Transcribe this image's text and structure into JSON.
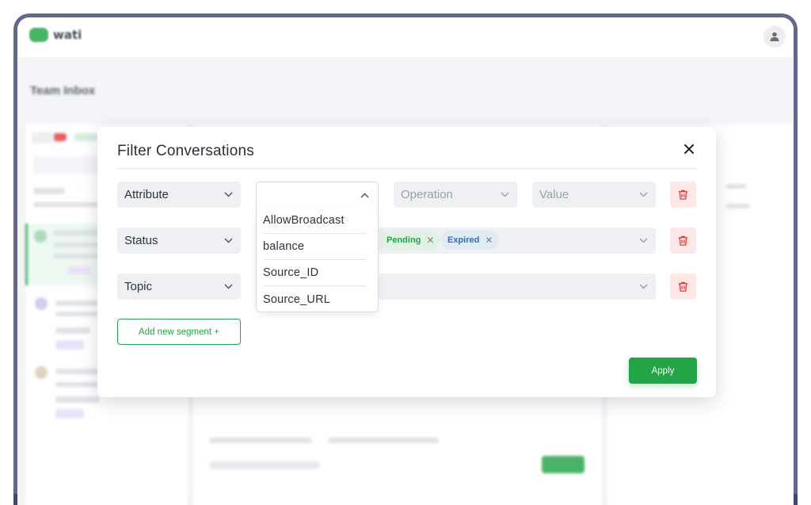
{
  "app": {
    "logo_text": "wati",
    "page_title": "Team Inbox"
  },
  "modal": {
    "title": "Filter Conversations",
    "rows": [
      {
        "field_label": "Attribute",
        "operation_placeholder": "Operation",
        "value_placeholder": "Value"
      },
      {
        "field_label": "Status",
        "tags": [
          "Pending",
          "Expired"
        ]
      },
      {
        "field_label": "Topic"
      }
    ],
    "dropdown_options": [
      "AllowBroadcast",
      "balance",
      "Source_ID",
      "Source_URL"
    ],
    "add_segment_label": "Add new segment +",
    "apply_label": "Apply",
    "close_glyph": "✕"
  },
  "colors": {
    "accent": "#22a447",
    "danger": "#e23b3b",
    "danger_bg": "#fde8e8",
    "frame": "#3f4a73"
  },
  "icons": [
    "user-icon",
    "close-icon",
    "chevron-down-icon",
    "chevron-up-icon",
    "trash-icon",
    "remove-tag-icon"
  ]
}
